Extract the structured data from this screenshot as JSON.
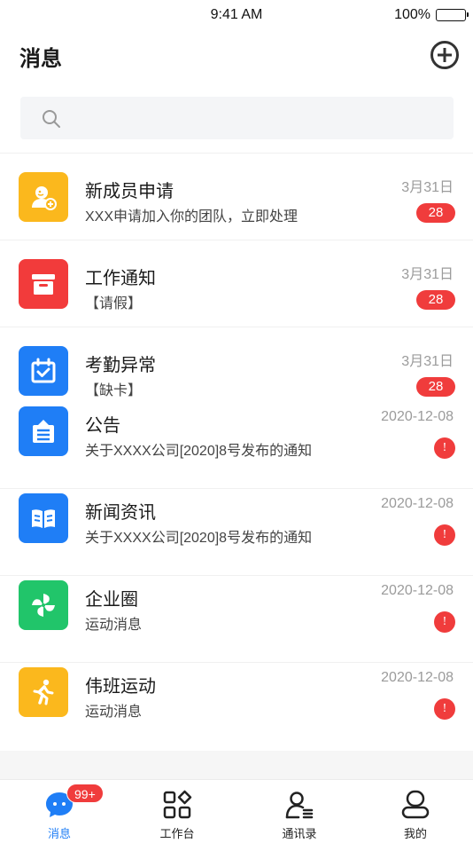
{
  "status_bar": {
    "time": "9:41 AM",
    "battery": "100%"
  },
  "header": {
    "title": "消息"
  },
  "search": {
    "placeholder": ""
  },
  "messages": [
    {
      "title": "新成员申请",
      "subtitle": "XXX申请加入你的团队，立即处理",
      "date": "3月31日",
      "badge": "28",
      "icon": "new-member-icon",
      "color": "#fbb81d"
    },
    {
      "title": "工作通知",
      "subtitle": "【请假】",
      "date": "3月31日",
      "badge": "28",
      "icon": "inbox-icon",
      "color": "#f23b3b"
    },
    {
      "title": "考勤异常",
      "subtitle": "【缺卡】",
      "date": "3月31日",
      "badge": "28",
      "icon": "calendar-check-icon",
      "color": "#1f7ef6"
    },
    {
      "title": "公告",
      "subtitle": "关于XXXX公司[2020]8号发布的通知",
      "date": "2020-12-08",
      "badge": "!",
      "icon": "announcement-icon",
      "color": "#1f7ef6"
    },
    {
      "title": "新闻资讯",
      "subtitle": "关于XXXX公司[2020]8号发布的通知",
      "date": "2020-12-08",
      "badge": "!",
      "icon": "book-icon",
      "color": "#1f7ef6"
    },
    {
      "title": "企业圈",
      "subtitle": "运动消息",
      "date": "2020-12-08",
      "badge": "!",
      "icon": "pinwheel-icon",
      "color": "#21c56a"
    },
    {
      "title": "伟班运动",
      "subtitle": "运动消息",
      "date": "2020-12-08",
      "badge": "!",
      "icon": "running-icon",
      "color": "#fbb81d"
    }
  ],
  "tabbar": {
    "items": [
      {
        "label": "消息",
        "icon": "chat-icon",
        "badge": "99+",
        "active": true
      },
      {
        "label": "工作台",
        "icon": "grid-icon"
      },
      {
        "label": "通讯录",
        "icon": "contacts-icon"
      },
      {
        "label": "我的",
        "icon": "profile-icon"
      }
    ]
  },
  "colors": {
    "accent": "#1f7ef6",
    "badge": "#f03c3c"
  }
}
